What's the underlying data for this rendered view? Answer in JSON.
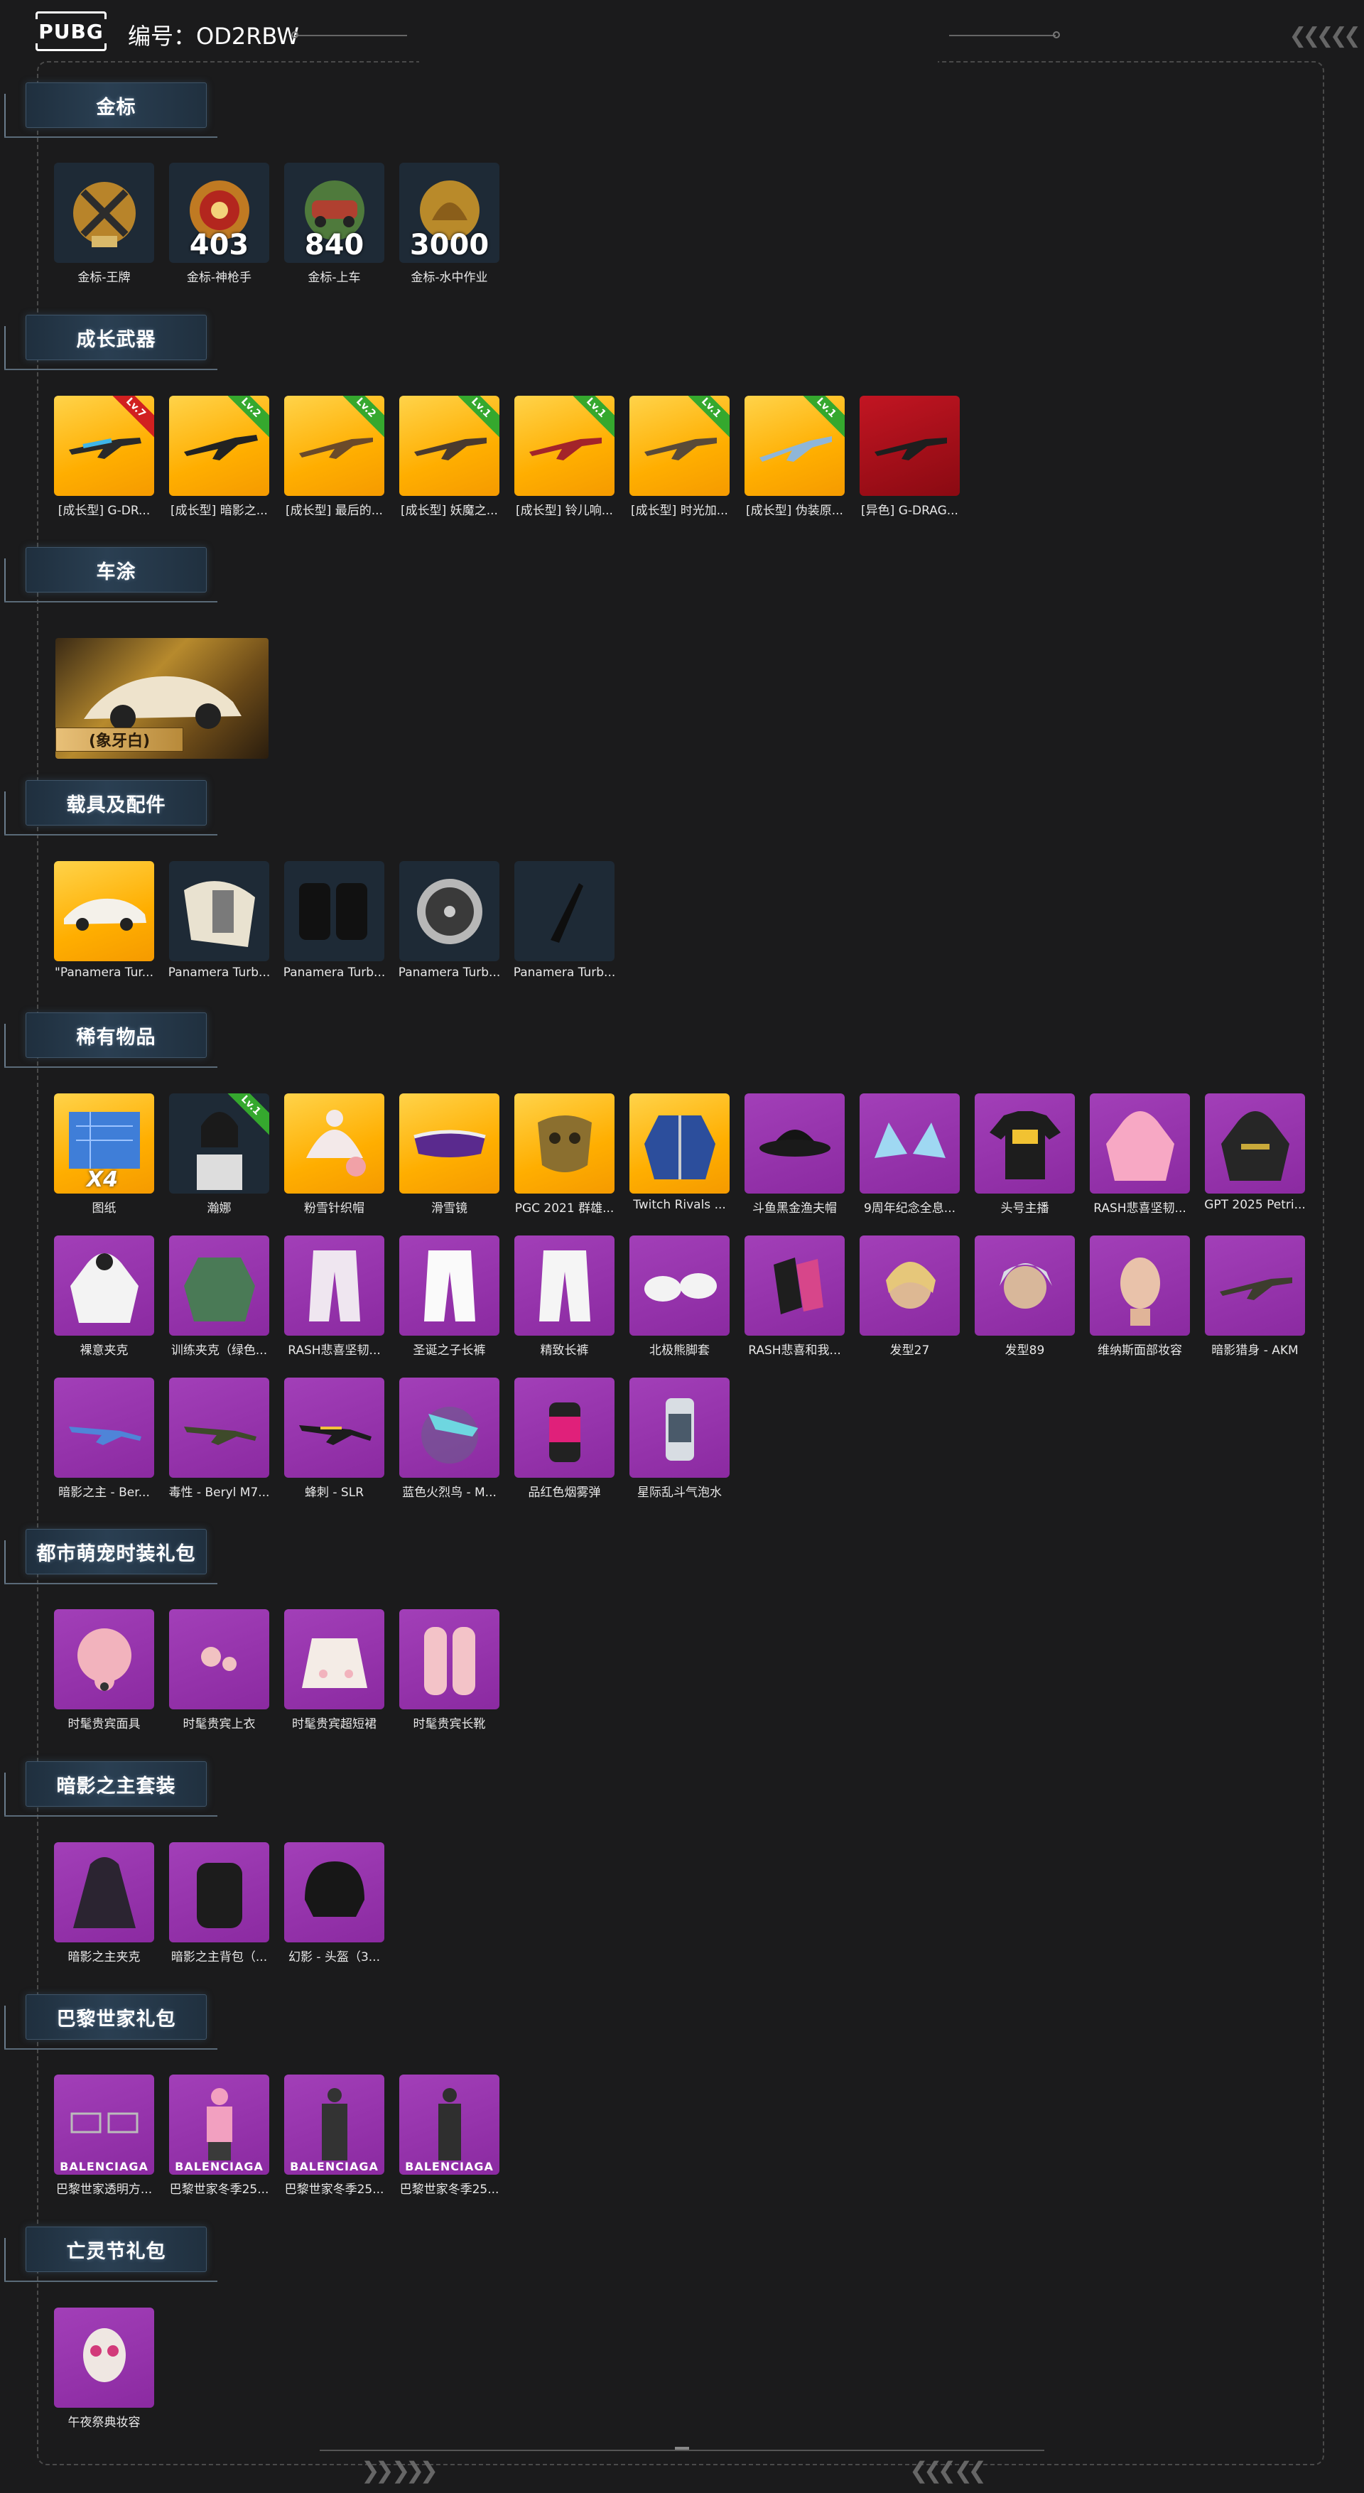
{
  "header": {
    "logo": "PUBG",
    "id_label": "编号：OD2RBW",
    "chevrons_right": "❮❮❮❮❮"
  },
  "sections": [
    {
      "title": "金标",
      "items": [
        {
          "caption": "金标-王牌",
          "num": ""
        },
        {
          "caption": "金标-神枪手",
          "num": "403"
        },
        {
          "caption": "金标-上车",
          "num": "840"
        },
        {
          "caption": "金标-水中作业",
          "num": "3000"
        }
      ]
    },
    {
      "title": "成长武器",
      "items": [
        {
          "caption": "[成长型] G-DR...",
          "badge": "Lv.7"
        },
        {
          "caption": "[成长型] 暗影之...",
          "badge": "Lv.2"
        },
        {
          "caption": "[成长型] 最后的...",
          "badge": "Lv.2"
        },
        {
          "caption": "[成长型] 妖魔之...",
          "badge": "Lv.1"
        },
        {
          "caption": "[成长型] 铃儿响...",
          "badge": "Lv.1"
        },
        {
          "caption": "[成长型] 时光加...",
          "badge": "Lv.1"
        },
        {
          "caption": "[成长型] 伪装原...",
          "badge": "Lv.1"
        },
        {
          "caption": "[异色] G-DRAG...",
          "badge": ""
        }
      ]
    },
    {
      "title": "车涂",
      "skin_tag": "(象牙白)"
    },
    {
      "title": "载具及配件",
      "items": [
        {
          "caption": "\"Panamera Tur..."
        },
        {
          "caption": "Panamera Turb..."
        },
        {
          "caption": "Panamera Turb..."
        },
        {
          "caption": "Panamera Turb..."
        },
        {
          "caption": "Panamera Turb..."
        }
      ]
    },
    {
      "title": "稀有物品",
      "rows": [
        [
          {
            "caption": "图纸",
            "x": "X4"
          },
          {
            "caption": "瀚娜",
            "badge": "Lv.1"
          },
          {
            "caption": "粉雪针织帽"
          },
          {
            "caption": "滑雪镜"
          },
          {
            "caption": "PGC 2021 群雄..."
          },
          {
            "caption": "Twitch Rivals ..."
          },
          {
            "caption": "斗鱼黑金渔夫帽"
          },
          {
            "caption": "9周年纪念全息..."
          },
          {
            "caption": "头号主播"
          },
          {
            "caption": "RASH悲喜坚韧..."
          },
          {
            "caption": "GPT 2025 Petri..."
          }
        ],
        [
          {
            "caption": "裸意夹克"
          },
          {
            "caption": "训练夹克（绿色..."
          },
          {
            "caption": "RASH悲喜坚韧..."
          },
          {
            "caption": "圣诞之子长裤"
          },
          {
            "caption": "精致长裤"
          },
          {
            "caption": "北极熊脚套"
          },
          {
            "caption": "RASH悲喜和我..."
          },
          {
            "caption": "发型27"
          },
          {
            "caption": "发型89"
          },
          {
            "caption": "维纳斯面部妆容"
          },
          {
            "caption": "暗影猎身 - AKM"
          }
        ],
        [
          {
            "caption": "暗影之主 - Ber..."
          },
          {
            "caption": "毒性 - Beryl M7..."
          },
          {
            "caption": "蜂刺 - SLR"
          },
          {
            "caption": "蓝色火烈鸟 - M..."
          },
          {
            "caption": "品红色烟雾弹"
          },
          {
            "caption": "星际乱斗气泡水"
          }
        ]
      ]
    },
    {
      "title": "都市萌宠时装礼包",
      "items": [
        {
          "caption": "时髦贵宾面具"
        },
        {
          "caption": "时髦贵宾上衣"
        },
        {
          "caption": "时髦贵宾超短裙"
        },
        {
          "caption": "时髦贵宾长靴"
        }
      ]
    },
    {
      "title": "暗影之主套装",
      "items": [
        {
          "caption": "暗影之主夹克"
        },
        {
          "caption": "暗影之主背包（..."
        },
        {
          "caption": "幻影 - 头盔（3..."
        }
      ]
    },
    {
      "title": "巴黎世家礼包",
      "items": [
        {
          "caption": "巴黎世家透明方...",
          "brand": "BALENCIAGA"
        },
        {
          "caption": "巴黎世家冬季25...",
          "brand": "BALENCIAGA"
        },
        {
          "caption": "巴黎世家冬季25...",
          "brand": "BALENCIAGA"
        },
        {
          "caption": "巴黎世家冬季25...",
          "brand": "BALENCIAGA"
        }
      ]
    },
    {
      "title": "亡灵节礼包",
      "items": [
        {
          "caption": "午夜祭典妆容"
        }
      ]
    }
  ],
  "footer": {
    "chev_left": "❯❯ ❯❯❯",
    "chev_right": "❮❮❮ ❮❮"
  }
}
